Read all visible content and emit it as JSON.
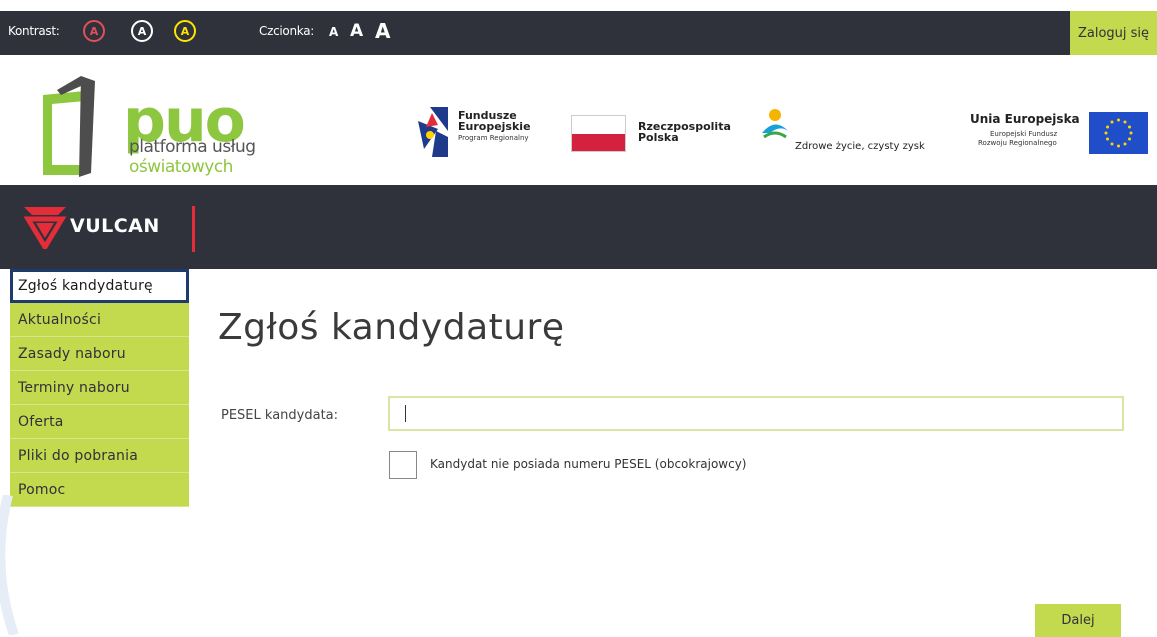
{
  "topbar": {
    "contrast_label": "Kontrast:",
    "contrast_buttons": [
      "A",
      "A",
      "A"
    ],
    "font_label": "Czcionka:",
    "font_sizes": [
      "A",
      "A",
      "A"
    ],
    "login_label": "Zaloguj się"
  },
  "logos": {
    "puo_main": "puo",
    "puo_line1": "platforma usług",
    "puo_line2": "oświatowych",
    "fe_line1": "Fundusze",
    "fe_line2": "Europejskie",
    "fe_line3": "Program Regionalny",
    "rp_line1": "Rzeczpospolita",
    "rp_line2": "Polska",
    "region_tagline": "Zdrowe życie, czysty zysk",
    "ue_line1": "Unia Europejska",
    "ue_line2": "Europejski Fundusz",
    "ue_line3": "Rozwoju Regionalnego",
    "vulcan": "VULCAN"
  },
  "nav": {
    "items": [
      {
        "label": "Zgłoś kandydaturę",
        "active": true
      },
      {
        "label": "Aktualności"
      },
      {
        "label": "Zasady naboru"
      },
      {
        "label": "Terminy naboru"
      },
      {
        "label": "Oferta"
      },
      {
        "label": "Pliki do pobrania"
      },
      {
        "label": "Pomoc"
      }
    ]
  },
  "main": {
    "title": "Zgłoś kandydaturę",
    "pesel_label": "PESEL kandydata:",
    "pesel_value": "",
    "no_pesel_label": "Kandydat nie posiada numeru PESEL (obcokrajowcy)",
    "next_button": "Dalej"
  },
  "colors": {
    "accent": "#c3d94e",
    "dark": "#2f323a",
    "active_border": "#1f3a6e",
    "brand_red": "#e52d3a"
  }
}
